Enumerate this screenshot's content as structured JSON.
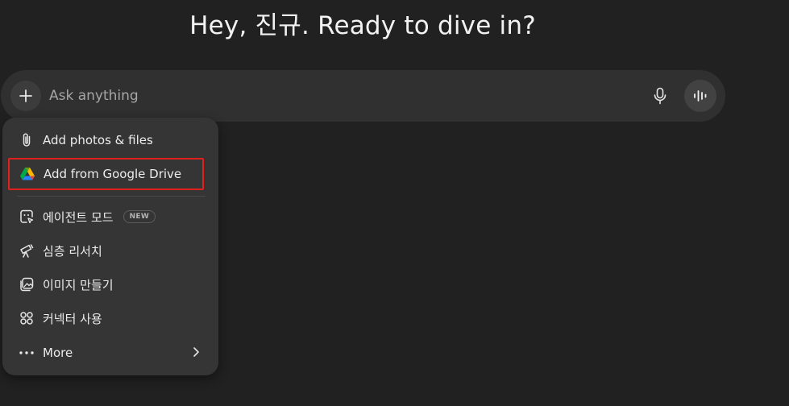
{
  "greeting": "Hey, 진규. Ready to dive in?",
  "composer": {
    "placeholder": "Ask anything",
    "plus_icon": "plus-icon",
    "mic_icon": "microphone-icon",
    "voice_icon": "voice-mode-icon"
  },
  "menu": {
    "items": [
      {
        "label": "Add photos & files",
        "icon": "paperclip-icon"
      },
      {
        "label": "Add from Google Drive",
        "icon": "google-drive-icon"
      },
      {
        "label": "에이전트 모드",
        "icon": "agent-icon",
        "badge": "NEW"
      },
      {
        "label": "심층 리서치",
        "icon": "telescope-icon"
      },
      {
        "label": "이미지 만들기",
        "icon": "image-icon"
      },
      {
        "label": "커넥터 사용",
        "icon": "connectors-icon"
      },
      {
        "label": "More",
        "icon": "more-dots-icon"
      }
    ]
  },
  "colors": {
    "background": "#212121",
    "composer": "#303030",
    "menu": "#353535",
    "highlight_border": "#e0201b"
  }
}
